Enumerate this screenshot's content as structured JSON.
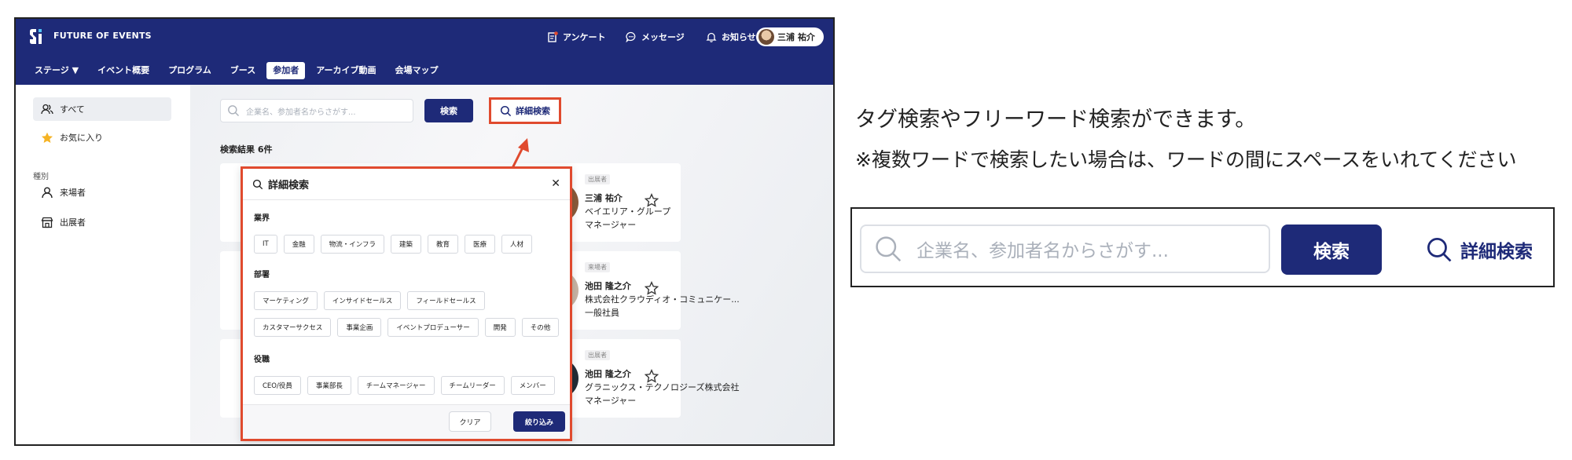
{
  "app": {
    "brand": "FUTURE OF EVENTS",
    "colors": {
      "primary": "#1e2a78",
      "highlight": "#e04a2e"
    }
  },
  "topbar": {
    "survey_label": "アンケート",
    "messages_label": "メッセージ",
    "notifications_label": "お知らせ",
    "user_name": "三浦 祐介"
  },
  "nav": {
    "items": [
      "ステージ ▼",
      "イベント概要",
      "プログラム",
      "ブース",
      "参加者",
      "アーカイブ動画",
      "会場マップ"
    ],
    "active": "参加者"
  },
  "sidebar": {
    "all_label": "すべて",
    "favorites_label": "お気に入り",
    "category_heading": "種別",
    "visitors_label": "来場者",
    "exhibitors_label": "出展者"
  },
  "search": {
    "placeholder": "企業名、参加者名からさがす...",
    "button_label": "検索",
    "advanced_label": "詳細検索",
    "result_count": "検索結果 6件"
  },
  "results": [
    {
      "role": "出展者",
      "name": "三浦 祐介",
      "company": "ベイエリア・グループ",
      "title": "マネージャー"
    },
    {
      "role": "来場者",
      "name": "池田 隆之介",
      "company": "株式会社クラウディオ・コミュニケー...",
      "title": "一般社員"
    },
    {
      "role": "出展者",
      "name": "池田 隆之介",
      "company": "グラニックス・テクノロジーズ株式会社",
      "title": "マネージャー"
    }
  ],
  "modal": {
    "title": "詳細検索",
    "close_icon": "close-icon",
    "industry_heading": "業界",
    "industry_tags": [
      "IT",
      "金融",
      "物流・インフラ",
      "建築",
      "教育",
      "医療",
      "人材"
    ],
    "department_heading": "部署",
    "department_tags_row1": [
      "マーケティング",
      "インサイドセールス",
      "フィールドセールス"
    ],
    "department_tags_row2": [
      "カスタマーサクセス",
      "事業企画",
      "イベントプロデューサー",
      "開発",
      "その他"
    ],
    "position_heading": "役職",
    "position_tags": [
      "CEO/役員",
      "事業部長",
      "チームマネージャー",
      "チームリーダー",
      "メンバー"
    ],
    "clear_label": "クリア",
    "apply_label": "絞り込み"
  },
  "notes": {
    "line1": "タグ検索やフリーワード検索ができます。",
    "line2": "※複数ワードで検索したい場合は、ワードの間にスペースをいれてください"
  },
  "zoom": {
    "placeholder": "企業名、参加者名からさがす...",
    "button_label": "検索",
    "advanced_label": "詳細検索"
  }
}
